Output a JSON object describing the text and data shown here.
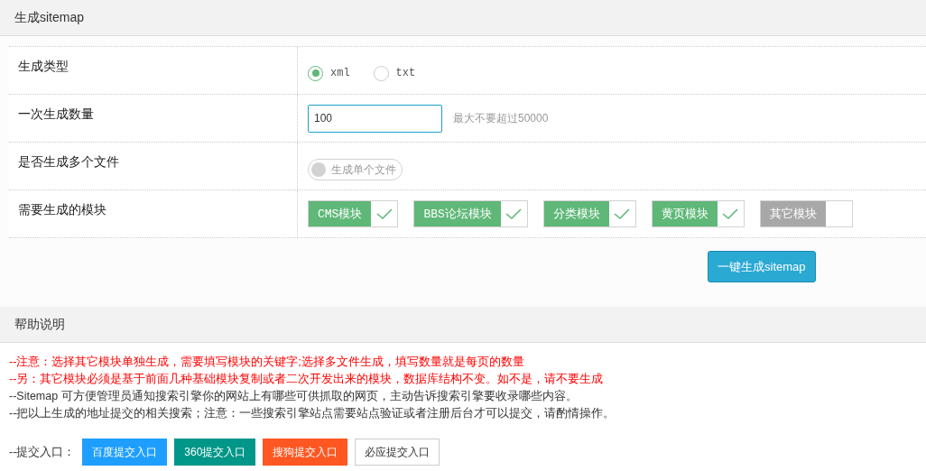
{
  "form_panel": {
    "title": "生成sitemap",
    "rows": [
      {
        "kind": "radio",
        "label": "生成类型",
        "options": [
          {
            "label": "xml",
            "selected": true
          },
          {
            "label": "txt",
            "selected": false
          }
        ]
      },
      {
        "kind": "number",
        "label": "一次生成数量",
        "value": "100",
        "hint": "最大不要超过50000"
      },
      {
        "kind": "toggle",
        "label": "是否生成多个文件",
        "toggle": {
          "on": false,
          "label": "生成单个文件"
        }
      },
      {
        "kind": "modules",
        "label": "需要生成的模块",
        "modules": [
          {
            "label": "CMS模块",
            "checked": true
          },
          {
            "label": "BBS论坛模块",
            "checked": true
          },
          {
            "label": "分类模块",
            "checked": true
          },
          {
            "label": "黄页模块",
            "checked": true
          },
          {
            "label": "其它模块",
            "checked": false
          }
        ]
      }
    ],
    "submit": "一键生成sitemap"
  },
  "help_panel": {
    "title": "帮助说明",
    "lines": [
      {
        "kind": "warning",
        "text": "--注意：选择其它模块单独生成，需要填写模块的关键字;选择多文件生成，填写数量就是每页的数量"
      },
      {
        "kind": "warning",
        "text": "--另：其它模块必须是基于前面几种基础模块复制或者二次开发出来的模块，数据库结构不变。如不是，请不要生成"
      },
      {
        "kind": "normal",
        "text": "--Sitemap 可方便管理员通知搜索引擎你的网站上有哪些可供抓取的网页，主动告诉搜索引擎要收录哪些内容。"
      },
      {
        "kind": "normal",
        "text": "--把以上生成的地址提交的相关搜索；注意：一些搜索引擎站点需要站点验证或者注册后台才可以提交，请酌情操作。"
      }
    ],
    "submit_label": "--提交入口：",
    "submit_links": [
      {
        "label": "百度提交入口",
        "color": "#1e9fff"
      },
      {
        "label": "360提交入口",
        "color": "#009688"
      },
      {
        "label": "搜狗提交入口",
        "color": "#ff5722"
      },
      {
        "label": "必应提交入口",
        "color": "#ffffff"
      }
    ]
  }
}
